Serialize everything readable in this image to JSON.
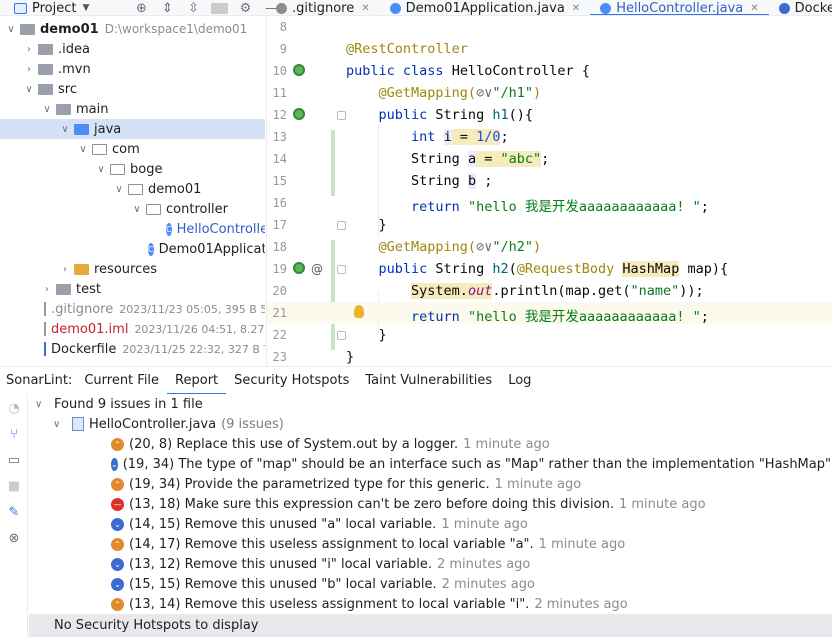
{
  "top": {
    "project_label": "Project",
    "editor_tabs": [
      {
        "label": ".gitignore",
        "color": "#8c8c8c",
        "active": false
      },
      {
        "label": "Demo01Application.java",
        "color": "#4c8cf5",
        "active": false
      },
      {
        "label": "HelloController.java",
        "color": "#4c8cf5",
        "active": true
      },
      {
        "label": "Dockerfile",
        "color": "#3c6ccf",
        "active": false
      }
    ]
  },
  "tree": {
    "root": {
      "name": "demo01",
      "path": "D:\\workspace1\\demo01"
    },
    "idea": ".idea",
    "mvn": ".mvn",
    "src": "src",
    "main": "main",
    "java": "java",
    "com": "com",
    "boge": "boge",
    "demo01": "demo01",
    "controller": "controller",
    "hello_controller": "HelloController",
    "demo01_application": "Demo01Application",
    "resources": "resources",
    "test": "test",
    "gitignore": {
      "name": ".gitignore",
      "meta": "2023/11/23 05:05, 395 B 5 m"
    },
    "iml": {
      "name": "demo01.iml",
      "meta": "2023/11/26 04:51, 8.27 kB"
    },
    "dockerfile": {
      "name": "Dockerfile",
      "meta": "2023/11/25 22:32, 327 B To"
    }
  },
  "editor": {
    "line_numbers": [
      "8",
      "9",
      "10",
      "11",
      "12",
      "13",
      "14",
      "15",
      "16",
      "17",
      "18",
      "19",
      "20",
      "21",
      "22",
      "23"
    ],
    "l9": "@RestController",
    "l10_kw1": "public",
    "l10_kw2": "class",
    "l10_rest": " HelloController {",
    "l11_an": "@GetMapping(",
    "l11_str": "\"/h1\"",
    "l11_end": ")",
    "l12_kw": "public",
    "l12_rest": " String ",
    "l12_fn": "h1",
    "l12_end": "(){",
    "l13_kw": "int",
    "l13_var": "i",
    "l13_eq": " = ",
    "l13_num": "1/0",
    "l13_end": ";",
    "l14_a": "String ",
    "l14_var": "a",
    "l14_b": " = ",
    "l14_str": "\"abc\"",
    "l14_end": ";",
    "l15_a": "String ",
    "l15_var": "b",
    "l15_end": " ;",
    "l16_kw": "return",
    "l16_str": "\"hello 我是开发aaaaaaaaaaaa! \"",
    "l16_end": ";",
    "l17": "}",
    "l18_an": "@GetMapping(",
    "l18_str": "\"/h2\"",
    "l18_end": ")",
    "l19_kw": "public",
    "l19_a": " String ",
    "l19_fn": "h2",
    "l19_b": "(",
    "l19_an": "@RequestBody",
    "l19_c": " ",
    "l19_type": "HashMap",
    "l19_d": " map){",
    "l20_a": "System.",
    "l20_st": "out",
    "l20_b": ".println(map.get(",
    "l20_str": "\"name\"",
    "l20_c": "));",
    "l21_kw": "return",
    "l21_str": "\"hello 我是开发aaaaaaaaaaaa! \"",
    "l21_end": ";",
    "l22": "}",
    "l23": "}",
    "at_icon": "@"
  },
  "sonarlint": {
    "label": "SonarLint:",
    "tabs": [
      "Current File",
      "Report",
      "Security Hotspots",
      "Taint Vulnerabilities",
      "Log"
    ],
    "active_tab": "Report",
    "summary": "Found 9 issues in 1 file",
    "file": {
      "name": "HelloController.java",
      "count": "(9 issues)"
    },
    "issues": [
      {
        "severity": "up",
        "loc": "(20, 8)",
        "msg": "Replace this use of System.out by a logger.",
        "ago": "1 minute ago"
      },
      {
        "severity": "down",
        "loc": "(19, 34)",
        "msg": "The type of \"map\" should be an interface such as \"Map\" rather than the implementation \"HashMap\".",
        "ago": "1 minute ago"
      },
      {
        "severity": "up",
        "loc": "(19, 34)",
        "msg": "Provide the parametrized type for this generic.",
        "ago": "1 minute ago"
      },
      {
        "severity": "block",
        "loc": "(13, 18)",
        "msg": "Make sure this expression can't be zero before doing this division.",
        "ago": "1 minute ago"
      },
      {
        "severity": "down",
        "loc": "(14, 15)",
        "msg": "Remove this unused \"a\" local variable.",
        "ago": "1 minute ago"
      },
      {
        "severity": "up",
        "loc": "(14, 17)",
        "msg": "Remove this useless assignment to local variable \"a\".",
        "ago": "1 minute ago"
      },
      {
        "severity": "down",
        "loc": "(13, 12)",
        "msg": "Remove this unused \"i\" local variable.",
        "ago": "2 minutes ago"
      },
      {
        "severity": "down",
        "loc": "(15, 15)",
        "msg": "Remove this unused \"b\" local variable.",
        "ago": "2 minutes ago"
      },
      {
        "severity": "up",
        "loc": "(13, 14)",
        "msg": "Remove this useless assignment to local variable \"i\".",
        "ago": "2 minutes ago"
      }
    ],
    "footer": "No Security Hotspots to display"
  }
}
